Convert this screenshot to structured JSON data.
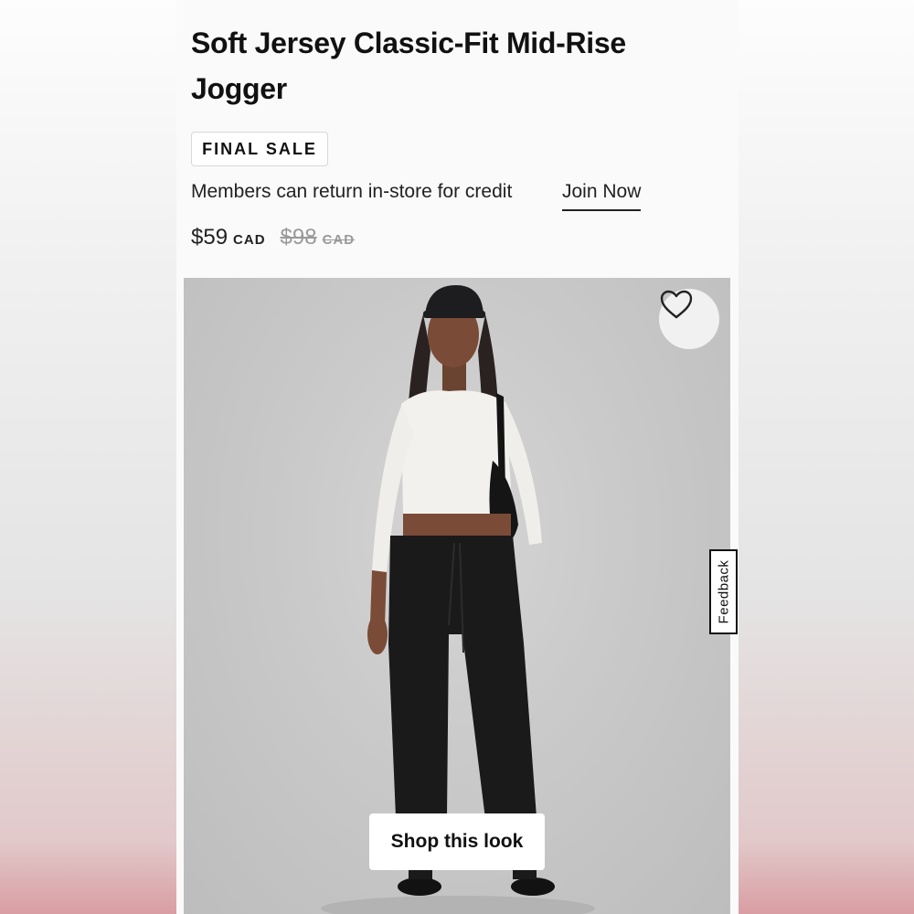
{
  "product": {
    "title": "Soft Jersey Classic-Fit Mid-Rise Jogger",
    "badge": "FINAL SALE",
    "members_text": "Members can return in-store for credit",
    "join_label": "Join Now",
    "price": "$59",
    "currency": "CAD",
    "original_price": "$98",
    "original_currency": "CAD"
  },
  "image": {
    "favorite_icon": "heart-icon",
    "shop_look_label": "Shop this look"
  },
  "feedback": {
    "label": "Feedback"
  },
  "colors": {
    "text": "#111111",
    "muted": "#999999",
    "photo_bg": "#c8c8c8"
  }
}
